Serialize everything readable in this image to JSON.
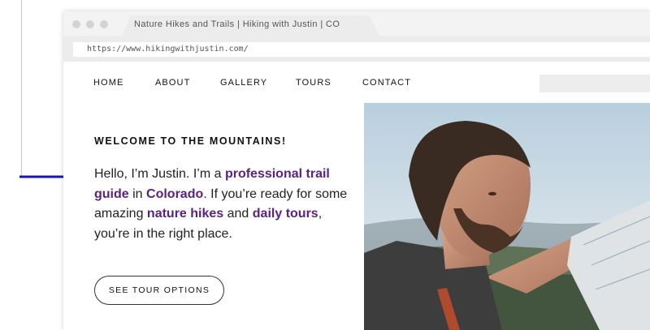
{
  "browser": {
    "tab_title": "Nature Hikes and Trails  |  Hiking with Justin  |  CO",
    "url": "https://www.hikingwithjustin.com/"
  },
  "nav": {
    "items": [
      "HOME",
      "ABOUT",
      "GALLERY",
      "TOURS",
      "CONTACT"
    ]
  },
  "hero": {
    "eyebrow": "WELCOME TO THE MOUNTAINS!",
    "intro": {
      "t1": "Hello, I’m Justin. I’m a ",
      "h1": "professional trail guide",
      "t2": " in ",
      "h2": "Colorado",
      "t3": ". If you’re ready for some amazing ",
      "h3": "nature hikes",
      "t4": " and ",
      "h4": "daily tours",
      "t5": ", you’re in the right place."
    },
    "cta_label": "SEE TOUR OPTIONS"
  },
  "colors": {
    "accent": "#5b2380",
    "annotation_arrow": "#1414c8"
  },
  "icons": {
    "annotation": "arrow-right-icon",
    "photo": "hiker-photo"
  }
}
